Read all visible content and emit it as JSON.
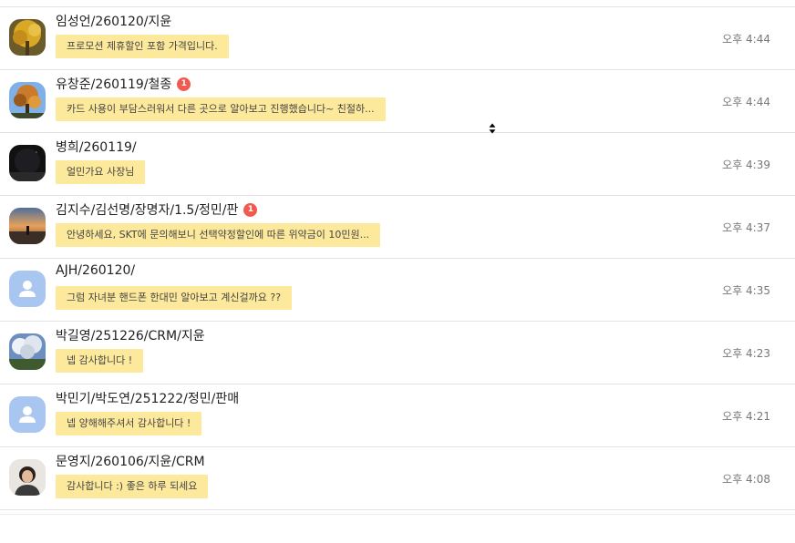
{
  "conversations": [
    {
      "name": "임성언/260120/지윤",
      "preview": "프로모션 제휴할인 포함 가격입니다.",
      "time": "오후 4:44",
      "unread": "",
      "avatar": "photo-yellow-tree"
    },
    {
      "name": "유창준/260119/철종",
      "preview": "카드 사용이 부담스러워서 다른 곳으로 알아보고 진행했습니다~ 친절하...",
      "time": "오후 4:44",
      "unread": "1",
      "avatar": "photo-autumn-tree"
    },
    {
      "name": "병희/260119/",
      "preview": "얼민가요 사장님",
      "time": "오후 4:39",
      "unread": "",
      "avatar": "photo-dark"
    },
    {
      "name": "김지수/김선명/장명자/1.5/정민/판",
      "preview": "안녕하세요, SKT에 문의해보니 선택약정할인에 따른 위약금이 10민원...",
      "time": "오후 4:37",
      "unread": "1",
      "avatar": "photo-sunset"
    },
    {
      "name": "AJH/260120/",
      "preview": "그럼 자녀분 핸드폰 한대민 알아보고 계신걸까요 ??",
      "time": "오후 4:35",
      "unread": "",
      "avatar": "default-user"
    },
    {
      "name": "박길영/251226/CRM/지윤",
      "preview": "넵 감사합니다 !",
      "time": "오후 4:23",
      "unread": "",
      "avatar": "photo-sky"
    },
    {
      "name": "박민기/박도연/251222/정민/판매",
      "preview": "넵 양해해주셔서 감사합니다 !",
      "time": "오후 4:21",
      "unread": "",
      "avatar": "default-user"
    },
    {
      "name": "문영지/260106/지윤/CRM",
      "preview": "감사합니다 :) 좋은 하루 되세요",
      "time": "오후 4:08",
      "unread": "",
      "avatar": "photo-person"
    }
  ],
  "colors": {
    "bubble": "#fde99c",
    "badge": "#f05a4f",
    "default_avatar": "#a9c6f1"
  }
}
